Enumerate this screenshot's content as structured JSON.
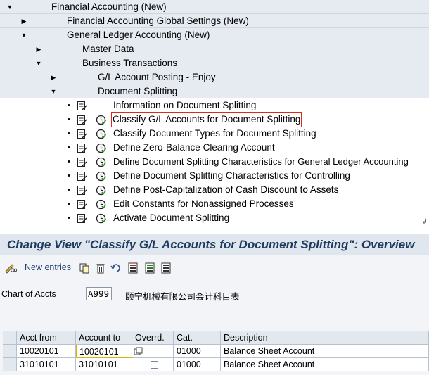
{
  "tree": {
    "nodes": [
      {
        "label": "Financial Accounting (New)",
        "level": "0",
        "state": "expanded"
      },
      {
        "label": "Financial Accounting Global Settings (New)",
        "level": "1",
        "state": "collapsed"
      },
      {
        "label": "General Ledger Accounting (New)",
        "level": "1",
        "state": "expanded"
      },
      {
        "label": "Master Data",
        "level": "2",
        "state": "collapsed"
      },
      {
        "label": "Business Transactions",
        "level": "2",
        "state": "expanded"
      },
      {
        "label": "G/L Account Posting - Enjoy",
        "level": "3",
        "state": "collapsed"
      },
      {
        "label": "Document Splitting",
        "level": "3",
        "state": "expanded"
      }
    ],
    "activities": [
      {
        "label": "Information on Document Splitting",
        "has_execute": "false",
        "highlighted": "false"
      },
      {
        "label": "Classify G/L Accounts for Document Splitting",
        "has_execute": "true",
        "highlighted": "true"
      },
      {
        "label": "Classify Document Types for Document Splitting",
        "has_execute": "true",
        "highlighted": "false"
      },
      {
        "label": "Define Zero-Balance Clearing Account",
        "has_execute": "true",
        "highlighted": "false"
      },
      {
        "label": "Define Document Splitting Characteristics for General Ledger Accounting",
        "has_execute": "true",
        "highlighted": "false"
      },
      {
        "label": "Define Document Splitting Characteristics for Controlling",
        "has_execute": "true",
        "highlighted": "false"
      },
      {
        "label": "Define Post-Capitalization of Cash Discount to Assets",
        "has_execute": "true",
        "highlighted": "false"
      },
      {
        "label": "Edit Constants for Nonassigned Processes",
        "has_execute": "true",
        "highlighted": "false"
      },
      {
        "label": "Activate Document Splitting",
        "has_execute": "true",
        "highlighted": "false"
      }
    ],
    "return_mark": "↲"
  },
  "view": {
    "title": "Change View \"Classify G/L Accounts for Document Splitting\": Overview",
    "toolbar": {
      "new_entries_label": "New entries",
      "icons": [
        "pencil-glasses-icon",
        "copy-icon",
        "delete-icon",
        "undo-icon",
        "select-all-icon",
        "select-block-icon",
        "deselect-all-icon"
      ]
    },
    "chart_of_accts": {
      "label": "Chart of Accts",
      "value": "A999",
      "description": "颐宁机械有限公司会计科目表"
    },
    "table": {
      "columns": [
        "Acct from",
        "Account to",
        "Overrd.",
        "Cat.",
        "Description"
      ],
      "rows": [
        {
          "acct_from": "10020101",
          "account_to": "10020101",
          "overrd": "unchecked",
          "cat": "01000",
          "description": "Balance Sheet Account"
        },
        {
          "acct_from": "31010101",
          "account_to": "31010101",
          "overrd": "unchecked",
          "cat": "01000",
          "description": "Balance Sheet Account"
        }
      ]
    }
  },
  "colors": {
    "title_text": "#1f3a5f",
    "highlight_border": "#e0281c",
    "focus_cell": "#fff6b0"
  }
}
